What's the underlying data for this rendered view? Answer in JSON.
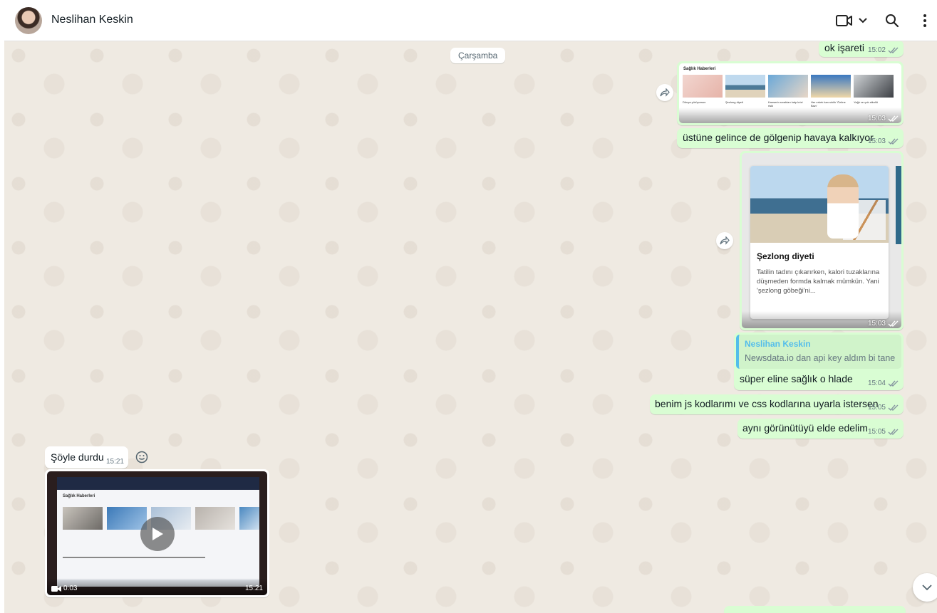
{
  "header": {
    "contact_name": "Neslihan Keskin"
  },
  "day_divider": "Çarşamba",
  "messages": {
    "m1": {
      "text": "ok işareti",
      "time": "15:02"
    },
    "m2": {
      "time": "15:03",
      "shot_title": "Sağlık Haberleri",
      "captions": [
        "Dünya yürüyorsun",
        "Şezlong diyeti",
        "Kanserin sıcakları kalp krizi riski",
        "Her erkek kan sıklık 'Özüne Bazı'",
        "Yağlı ve çok alkollü"
      ]
    },
    "m3": {
      "text": "üstüne gelince de gölgenip havaya kalkıyor",
      "time": "15:03"
    },
    "m4": {
      "time": "15:03",
      "card_title": "Şezlong diyeti",
      "card_text": "Tatilin tadını çıkarırken, kalori tuzaklarına düşmeden formda kalmak mümkün. Yani 'şezlong göbeği'ni..."
    },
    "m5": {
      "quote_name": "Neslihan Keskin",
      "quote_text": "Newsdata.io dan api key aldım bi tane",
      "text": "süper eline sağlık o hlade",
      "time": "15:04"
    },
    "m6": {
      "text": "benim js kodlarımı ve css kodlarına uyarla istersen",
      "time": "15:05"
    },
    "m7": {
      "text": "aynı görünütüyü elde edelim",
      "time": "15:05"
    },
    "m9": {
      "text": "Şöyle durdu",
      "time": "15:21"
    },
    "m10": {
      "duration": "0:03",
      "time": "15:21",
      "video_title": "Sağlık Haberleri"
    }
  },
  "colors": {
    "outgoing": "#d9fdd3",
    "incoming": "#ffffff",
    "quote_accent": "#53bdeb",
    "wallpaper": "#efeae2"
  },
  "icons": [
    "video-call-icon",
    "chevron-down-icon",
    "search-icon",
    "menu-dots-icon",
    "forward-icon",
    "double-check-icon",
    "play-icon",
    "emoji-icon",
    "arrow-down-icon"
  ]
}
